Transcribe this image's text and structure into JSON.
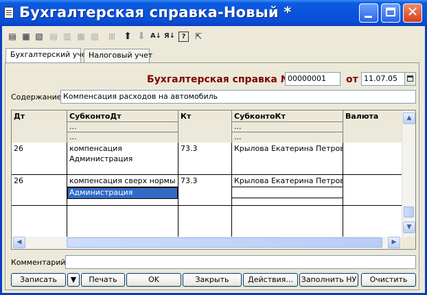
{
  "window": {
    "title": "Бухгалтерская справка-Новый *"
  },
  "toolbar": {
    "icons": [
      "add-row",
      "copy-row",
      "delete-row",
      "edit-row",
      "clone-row",
      "end-edit",
      "insert-row",
      "move-up",
      "move-down",
      "sort-asc",
      "sort-desc",
      "help",
      "pointer-help"
    ]
  },
  "tabs": [
    {
      "label": "Бухгалтерский учет",
      "active": true
    },
    {
      "label": "Налоговый учет",
      "active": false
    }
  ],
  "header": {
    "doc_label": "Бухгалтерская справка №",
    "doc_number": "00000001",
    "date_label": "от",
    "date": "11.07.05"
  },
  "content": {
    "label": "Содержание:",
    "value": "Компенсация расходов на автомобиль"
  },
  "grid": {
    "columns": [
      "Дт",
      "СубконтоДт",
      "Кт",
      "СубконтоКт",
      "Валюта"
    ],
    "header_sub": [
      "...",
      "..."
    ],
    "header_sub_kt": [
      "...",
      "..."
    ],
    "rows": [
      {
        "dt": "26",
        "subconto_dt": [
          "компенсация",
          "Администрация"
        ],
        "kt": "73.3",
        "subconto_kt": [
          "Крылова Екатерина Петровна",
          ""
        ],
        "currency": ""
      },
      {
        "dt": "26",
        "subconto_dt": [
          "компенсация сверх нормы",
          "Администрация"
        ],
        "kt": "73.3",
        "subconto_kt": [
          "Крылова Екатерина Петровна",
          ""
        ],
        "currency": ""
      }
    ]
  },
  "comment": {
    "label": "Комментарий:",
    "value": ""
  },
  "buttons": {
    "save": "Записать",
    "print": "Печать",
    "ok": "OK",
    "close": "Закрыть",
    "actions": "Действия...",
    "fill_nu": "Заполнить НУ",
    "clear": "Очистить"
  },
  "colors": {
    "title_bar": "#0A4ED8",
    "doc_label": "#7A0000",
    "selection": "#316AC5"
  }
}
